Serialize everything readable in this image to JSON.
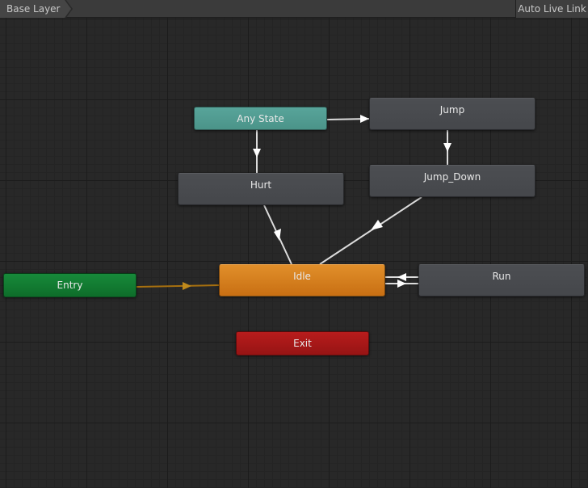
{
  "toolbar": {
    "breadcrumb_label": "Base Layer",
    "live_link_label": "Auto Live Link"
  },
  "states": {
    "any_state": "Any State",
    "jump": "Jump",
    "hurt": "Hurt",
    "jump_down": "Jump_Down",
    "idle": "Idle",
    "run": "Run",
    "entry": "Entry",
    "exit": "Exit"
  },
  "transitions": [
    {
      "from": "Any State",
      "to": "Jump"
    },
    {
      "from": "Any State",
      "to": "Hurt"
    },
    {
      "from": "Jump",
      "to": "Jump_Down"
    },
    {
      "from": "Hurt",
      "to": "Idle"
    },
    {
      "from": "Jump_Down",
      "to": "Idle"
    },
    {
      "from": "Run",
      "to": "Idle"
    },
    {
      "from": "Idle",
      "to": "Run"
    },
    {
      "from": "Entry",
      "to": "Idle",
      "default": true
    }
  ],
  "colors": {
    "background": "#282828",
    "state_default": "#47494d",
    "state_any": "#53a094",
    "state_entry": "#137d33",
    "state_exit": "#a81818",
    "state_default_layer": "#d5801f",
    "transition": "#dcdcdc",
    "transition_default": "#a7700f"
  }
}
